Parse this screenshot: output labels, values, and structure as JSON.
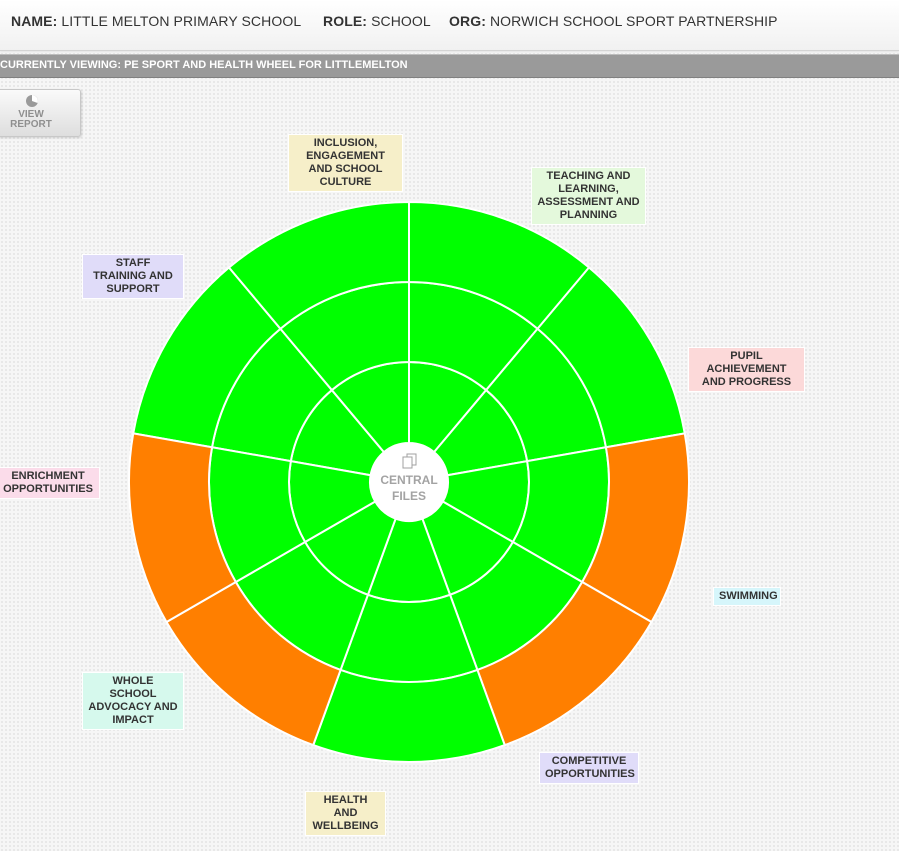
{
  "header": {
    "name_label": "NAME:",
    "name_value": "LITTLE MELTON PRIMARY SCHOOL",
    "role_label": "ROLE:",
    "role_value": "SCHOOL",
    "org_label": "ORG:",
    "org_value": "NORWICH SCHOOL SPORT PARTNERSHIP"
  },
  "viewing_bar": "CURRENTLY VIEWING: PE SPORT AND HEALTH WHEEL FOR LITTLEMELTON",
  "view_report": {
    "line1": "VIEW",
    "line2": "REPORT",
    "icon": "pie-chart-icon"
  },
  "center": {
    "line1": "CENTRAL",
    "line2": "FILES",
    "icon": "files-icon"
  },
  "colors": {
    "green": "#00ff00",
    "orange": "#ff7f00"
  },
  "wheel": {
    "sectors": [
      {
        "label": "TEACHING AND LEARNING, ASSESSMENT AND PLANNING",
        "label_bg": "#e4f9dc",
        "rings": [
          "green",
          "green",
          "green"
        ]
      },
      {
        "label": "PUPIL ACHIEVEMENT AND PROGRESS",
        "label_bg": "#fcd9d9",
        "rings": [
          "green",
          "green",
          "green"
        ]
      },
      {
        "label": "SWIMMING",
        "label_bg": "#d6f6fb",
        "rings": [
          "green",
          "green",
          "green"
        ]
      },
      {
        "label": "COMPETITIVE OPPORTUNITIES",
        "label_bg": "#e0dcf9",
        "rings": [
          "green",
          "green",
          "green"
        ]
      },
      {
        "label": "HEALTH AND WELLBEING",
        "label_bg": "#f6efc9",
        "rings": [
          "green",
          "green",
          "orange"
        ]
      },
      {
        "label": "WHOLE SCHOOL ADVOCACY AND IMPACT",
        "label_bg": "#d6f9ed",
        "rings": [
          "green",
          "green",
          "orange"
        ]
      },
      {
        "label": "ENRICHMENT OPPORTUNITIES",
        "label_bg": "#fbdcea",
        "rings": [
          "green",
          "green",
          "green"
        ]
      },
      {
        "label": "STAFF TRAINING AND SUPPORT",
        "label_bg": "#e0dcf9",
        "rings": [
          "green",
          "green",
          "orange"
        ]
      },
      {
        "label": "INCLUSION, ENGAGEMENT AND SCHOOL CULTURE",
        "label_bg": "#f6efc9",
        "rings": [
          "green",
          "green",
          "orange"
        ]
      }
    ]
  }
}
